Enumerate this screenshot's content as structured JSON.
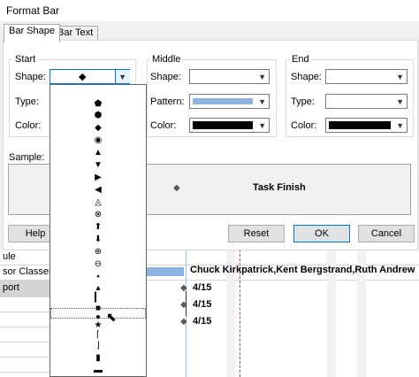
{
  "window": {
    "title": "Format Bar"
  },
  "tabs": [
    "Bar Shape",
    "Bar Text"
  ],
  "start": {
    "group_label": "Start",
    "shape_label": "Shape:",
    "shape_value": "◆",
    "type_label": "Type:",
    "color_label": "Color:"
  },
  "middle": {
    "group_label": "Middle",
    "shape_label": "Shape:",
    "pattern_label": "Pattern:",
    "color_label": "Color:",
    "pattern_color": "#8db3e2",
    "color_value": "#000000"
  },
  "end": {
    "group_label": "End",
    "shape_label": "Shape:",
    "type_label": "Type:",
    "color_label": "Color:",
    "color_value": "#000000"
  },
  "sample": {
    "label": "Sample:",
    "marker": "◆",
    "text": "Task Finish"
  },
  "buttons": {
    "help": "Help",
    "reset": "Reset",
    "ok": "OK",
    "cancel": "Cancel"
  },
  "background": {
    "rows": [
      "ule",
      "sor Classes",
      "port"
    ],
    "resources_text": "Chuck Kirkpatrick,Kent Bergstrand,Ruth Andrew",
    "dates": [
      "4/15",
      "4/15",
      "4/15"
    ]
  },
  "shape_list": {
    "items": [
      "⬟",
      "⬢",
      "◆",
      "◉",
      "▲",
      "▼",
      "▶",
      "◀",
      "◬",
      "⊗",
      "⬆",
      "⬇",
      "⊕",
      "⊖",
      "⬩",
      "▴",
      "▎",
      "■",
      "●",
      "★",
      "⌈",
      "⌋",
      "▮",
      "▬"
    ],
    "selected_index": 18
  }
}
